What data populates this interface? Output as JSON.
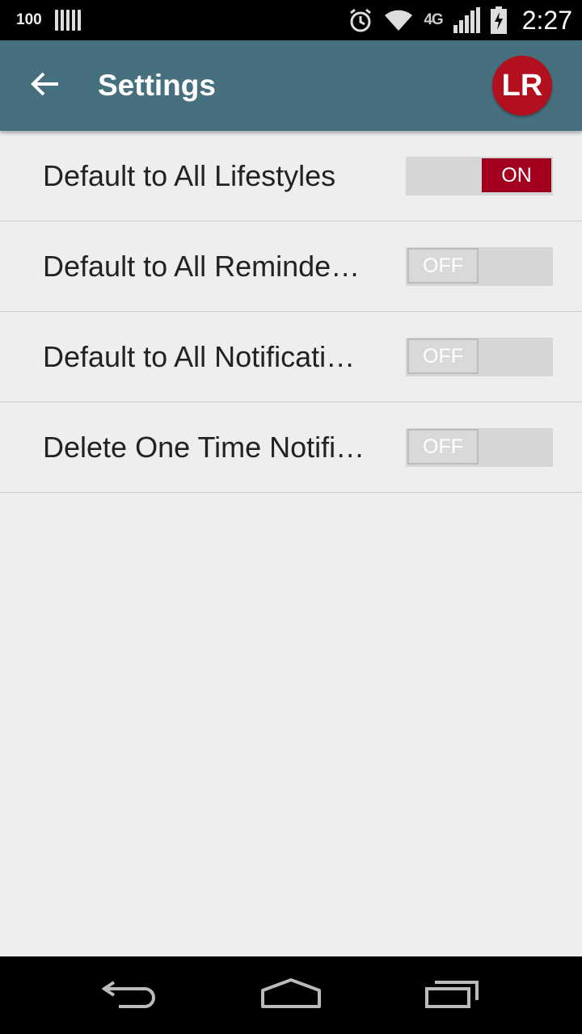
{
  "status_bar": {
    "battery_level_text": "100",
    "network": "4G",
    "time": "2:27",
    "icons": [
      "sim-bars-icon",
      "alarm-icon",
      "wifi-icon",
      "lte-icon",
      "signal-icon",
      "battery-charging-icon"
    ]
  },
  "app_bar": {
    "back_icon": "arrow-left-icon",
    "title": "Settings",
    "avatar_initials": "LR",
    "avatar_color": "#b3101f",
    "bar_color": "#47707f"
  },
  "settings": [
    {
      "label": "Default to All Lifestyles",
      "state": "ON"
    },
    {
      "label": "Default to All Reminde…",
      "state": "OFF"
    },
    {
      "label": "Default to All Notificati…",
      "state": "OFF"
    },
    {
      "label": "Delete One Time Notifi…",
      "state": "OFF"
    }
  ],
  "colors": {
    "toggle_on": "#a3001f",
    "toggle_track": "#d6d6d6",
    "background": "#eeeeee"
  },
  "nav_bar": {
    "icons": [
      "back-nav-icon",
      "home-nav-icon",
      "recent-apps-icon"
    ]
  }
}
